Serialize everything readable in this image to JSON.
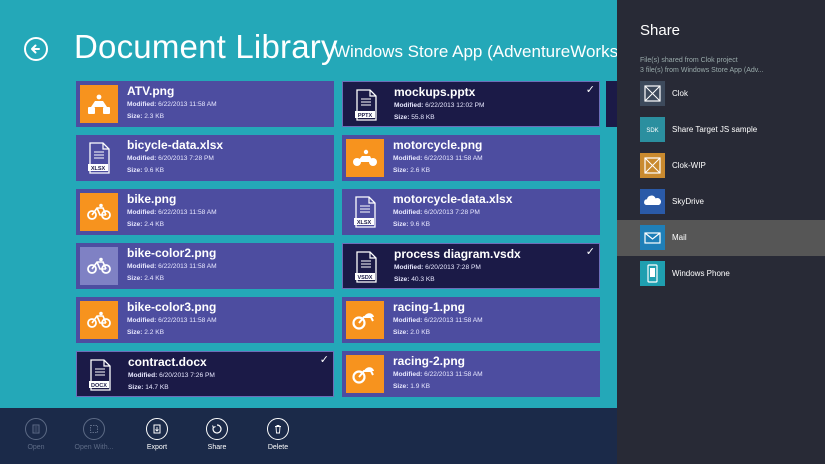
{
  "header": {
    "title": "Document Library",
    "subtitle": "Windows Store App (AdventureWorks Cyc"
  },
  "files": [
    {
      "name": "ATV.png",
      "modified_label": "Modified:",
      "modified": "6/22/2013 11:58 AM",
      "size_label": "Size:",
      "size": "2.3 KB",
      "thumb": "atv-icon",
      "thumb_color": "#f7931e",
      "selected": false
    },
    {
      "name": "bicycle-data.xlsx",
      "modified_label": "Modified:",
      "modified": "6/20/2013 7:28 PM",
      "size_label": "Size:",
      "size": "9.6 KB",
      "thumb": "xlsx-file-icon",
      "thumb_color": "none",
      "selected": false
    },
    {
      "name": "bike.png",
      "modified_label": "Modified:",
      "modified": "6/22/2013 11:58 AM",
      "size_label": "Size:",
      "size": "2.4 KB",
      "thumb": "bike-icon",
      "thumb_color": "#f7931e",
      "selected": false
    },
    {
      "name": "bike-color2.png",
      "modified_label": "Modified:",
      "modified": "6/22/2013 11:58 AM",
      "size_label": "Size:",
      "size": "2.4 KB",
      "thumb": "bike-icon",
      "thumb_color": "#7f81c4",
      "selected": false
    },
    {
      "name": "bike-color3.png",
      "modified_label": "Modified:",
      "modified": "6/22/2013 11:58 AM",
      "size_label": "Size:",
      "size": "2.2 KB",
      "thumb": "bike-icon",
      "thumb_color": "#f7931e",
      "selected": false
    },
    {
      "name": "contract.docx",
      "modified_label": "Modified:",
      "modified": "6/20/2013 7:26 PM",
      "size_label": "Size:",
      "size": "14.7 KB",
      "thumb": "docx-file-icon",
      "thumb_color": "none",
      "selected": true
    },
    {
      "name": "mockups.pptx",
      "modified_label": "Modified:",
      "modified": "6/22/2013 12:02 PM",
      "size_label": "Size:",
      "size": "55.8 KB",
      "thumb": "pptx-file-icon",
      "thumb_color": "none",
      "selected": true
    },
    {
      "name": "motorcycle.png",
      "modified_label": "Modified:",
      "modified": "6/22/2013 11:58 AM",
      "size_label": "Size:",
      "size": "2.6 KB",
      "thumb": "motorcycle-icon",
      "thumb_color": "#f7931e",
      "selected": false
    },
    {
      "name": "motorcycle-data.xlsx",
      "modified_label": "Modified:",
      "modified": "6/20/2013 7:28 PM",
      "size_label": "Size:",
      "size": "9.6 KB",
      "thumb": "xlsx-file-icon",
      "thumb_color": "none",
      "selected": false
    },
    {
      "name": "process diagram.vsdx",
      "modified_label": "Modified:",
      "modified": "6/20/2013 7:28 PM",
      "size_label": "Size:",
      "size": "40.3 KB",
      "thumb": "vsdx-file-icon",
      "thumb_color": "none",
      "selected": true
    },
    {
      "name": "racing-1.png",
      "modified_label": "Modified:",
      "modified": "6/22/2013 11:58 AM",
      "size_label": "Size:",
      "size": "2.0 KB",
      "thumb": "racing-bike-icon",
      "thumb_color": "#f7931e",
      "selected": false
    },
    {
      "name": "racing-2.png",
      "modified_label": "Modified:",
      "modified": "6/22/2013 11:58 AM",
      "size_label": "Size:",
      "size": "1.9 KB",
      "thumb": "racing-bike-icon",
      "thumb_color": "#f7931e",
      "selected": false
    }
  ],
  "file_doc_labels": {
    "xlsx": "XLSX",
    "docx": "DOCX",
    "pptx": "PPTX",
    "vsdx": "VSDX"
  },
  "appbar": {
    "open": "Open",
    "open_with": "Open With...",
    "export": "Export",
    "share": "Share",
    "delete": "Delete"
  },
  "share_pane": {
    "title": "Share",
    "source_line1": "File(s) shared from Clok project",
    "source_line2": "3 file(s) from Windows Store App (Adv...",
    "targets": [
      {
        "label": "Clok",
        "icon": "clok-icon",
        "color": "#3d4a5c"
      },
      {
        "label": "Share Target JS sample",
        "icon": "share-target-icon",
        "icon_text": "SDK",
        "color": "#2b8f9f"
      },
      {
        "label": "Clok-WIP",
        "icon": "clok-wip-icon",
        "color": "#c98a2f"
      },
      {
        "label": "SkyDrive",
        "icon": "skydrive-icon",
        "color": "#2a5aa8"
      },
      {
        "label": "Mail",
        "icon": "mail-icon",
        "color": "#1f7fb8"
      },
      {
        "label": "Windows Phone",
        "icon": "windows-phone-icon",
        "color": "#1f9fb0"
      }
    ],
    "highlighted": "Mail"
  },
  "colors": {
    "background": "#24a8b8",
    "tile": "#4d4da0",
    "tile_selected": "#1b1a47",
    "appbar": "#1b2a49",
    "pane": "#282a36",
    "accent_orange": "#f7931e"
  }
}
